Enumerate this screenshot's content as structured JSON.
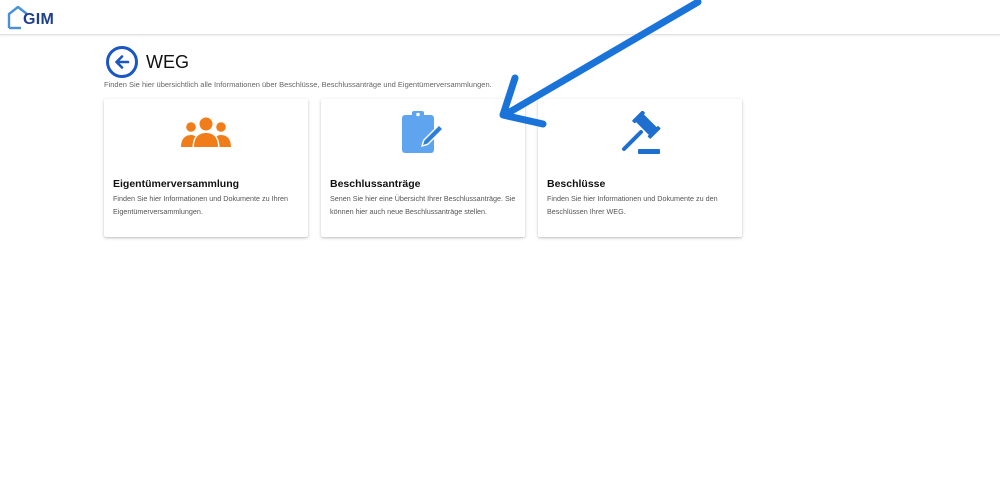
{
  "app": {
    "logo_text": "GIM"
  },
  "header": {
    "title": "WEG",
    "subtitle": "Finden Sie hier übersichtlich alle Informationen über Beschlüsse, Beschlussanträge und Eigentümerversammlungen."
  },
  "cards": [
    {
      "title": "Eigentümerversammlung",
      "description": "Finden Sie hier Informationen und Dokumente zu Ihren Eigentümerversammlungen.",
      "icon": "group-icon",
      "color": "#f07d1a"
    },
    {
      "title": "Beschlussanträge",
      "description": "Senen Sie hier eine Übersicht Ihrer Beschlussanträge. Sie können hier auch neue Beschlussanträge stellen.",
      "icon": "clipboard-edit-icon",
      "color": "#5ea4ee"
    },
    {
      "title": "Beschlüsse",
      "description": "Finden Sie hier Informationen und Dokumente zu den Beschlüssen Ihrer WEG.",
      "icon": "gavel-icon",
      "color": "#1f6fd0"
    }
  ],
  "colors": {
    "brand": "#1f3f8a",
    "back_button": "#1a56c4",
    "annotation_arrow": "#1a73d9"
  }
}
